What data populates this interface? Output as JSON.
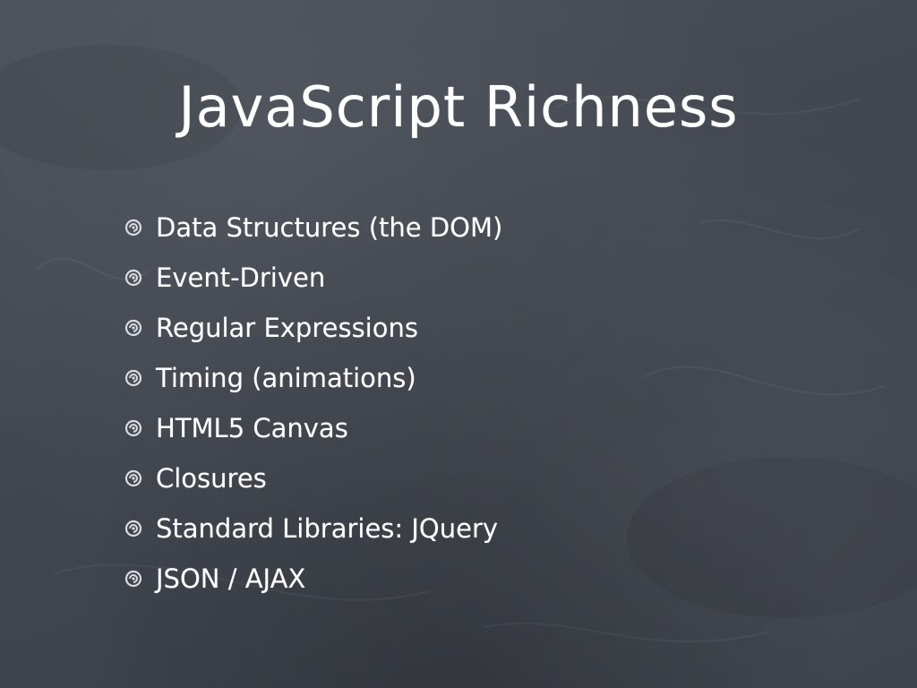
{
  "slide": {
    "title": "JavaScript Richness",
    "bullet_icon": "spiral-bullet-icon",
    "bullets": [
      "Data Structures (the DOM)",
      "Event-Driven",
      "Regular Expressions",
      "Timing (animations)",
      "HTML5 Canvas",
      "Closures",
      "Standard Libraries: JQuery",
      "JSON / AJAX"
    ]
  },
  "colors": {
    "background": "#41464f",
    "text": "#ffffff",
    "bullet": "#d9dbdf"
  }
}
